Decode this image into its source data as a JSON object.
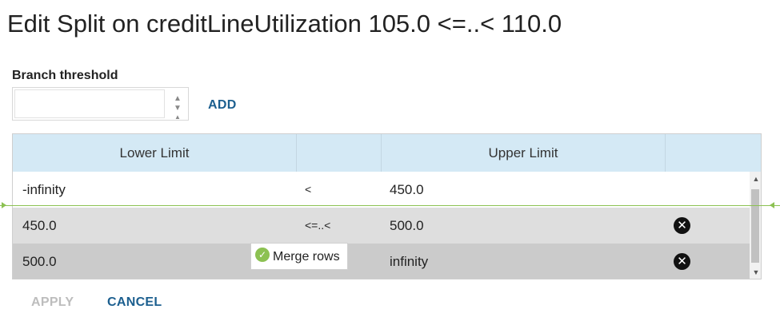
{
  "dialog": {
    "title": "Edit Split on creditLineUtilization 105.0 <=..< 110.0"
  },
  "threshold": {
    "label": "Branch threshold",
    "value": "",
    "placeholder": ""
  },
  "add_label": "ADD",
  "grid": {
    "headers": [
      "Lower Limit",
      "",
      "Upper Limit",
      ""
    ],
    "rows": [
      {
        "lower": "-infinity",
        "op": "<",
        "upper": "450.0",
        "deletable": false
      },
      {
        "lower": "450.0",
        "op": "<=..<",
        "upper": "500.0",
        "deletable": true
      },
      {
        "lower": "500.0",
        "op": "",
        "upper": "infinity",
        "deletable": true
      }
    ]
  },
  "merge_label": "Merge rows",
  "footer": {
    "apply_label": "APPLY",
    "cancel_label": "CANCEL"
  },
  "colors": {
    "header_bg": "#d4e9f5",
    "accent_link": "#1c5f8f",
    "split_line": "#8cc152",
    "row_alt_1": "#dedede",
    "row_alt_2": "#cbcbcb"
  },
  "icons": {
    "delete": "close-circle-icon",
    "merge": "check-circle-icon",
    "spinner_up": "caret-up-icon",
    "spinner_down": "caret-down-icon"
  }
}
